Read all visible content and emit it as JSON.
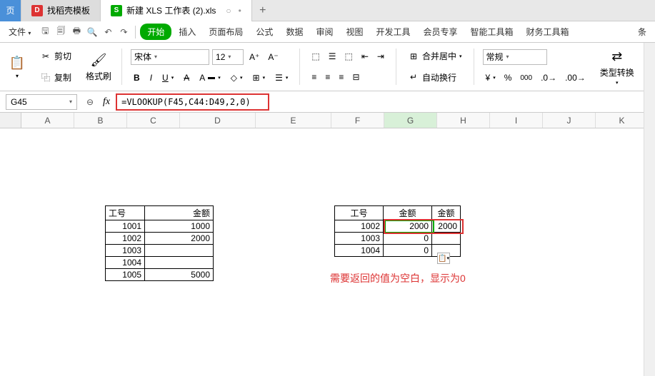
{
  "tabs": [
    {
      "icon": "D",
      "label": "找稻壳模板"
    },
    {
      "icon": "S",
      "label": "新建 XLS 工作表 (2).xls"
    }
  ],
  "qat": {
    "file": "文件"
  },
  "menu": {
    "start": "开始",
    "insert": "插入",
    "layout": "页面布局",
    "formula": "公式",
    "data": "数据",
    "review": "审阅",
    "view": "视图",
    "dev": "开发工具",
    "member": "会员专享",
    "smartbox": "智能工具箱",
    "finbox": "财务工具箱",
    "bar": "条"
  },
  "ribbon": {
    "cut": "剪切",
    "copy": "复制",
    "fmt_painter": "格式刷",
    "font_name": "宋体",
    "font_size": "12",
    "merge": "合并居中",
    "wrap": "自动换行",
    "number_fmt": "常规",
    "type_convert": "类型转换"
  },
  "name_box": "G45",
  "formula": "=VLOOKUP(F45,C44:D49,2,0)",
  "columns": [
    "A",
    "B",
    "C",
    "D",
    "E",
    "F",
    "G",
    "H",
    "I",
    "J",
    "K"
  ],
  "table1": {
    "headers": [
      "工号",
      "金额"
    ],
    "rows": [
      [
        "1001",
        "1000"
      ],
      [
        "1002",
        "2000"
      ],
      [
        "1003",
        ""
      ],
      [
        "1004",
        ""
      ],
      [
        "1005",
        "5000"
      ]
    ]
  },
  "table2": {
    "headers": [
      "工号",
      "金额",
      "金额"
    ],
    "rows": [
      [
        "1002",
        "2000",
        "2000"
      ],
      [
        "1003",
        "0",
        ""
      ],
      [
        "1004",
        "0",
        ""
      ]
    ]
  },
  "annotation": "需要返回的值为空白，显示为0"
}
